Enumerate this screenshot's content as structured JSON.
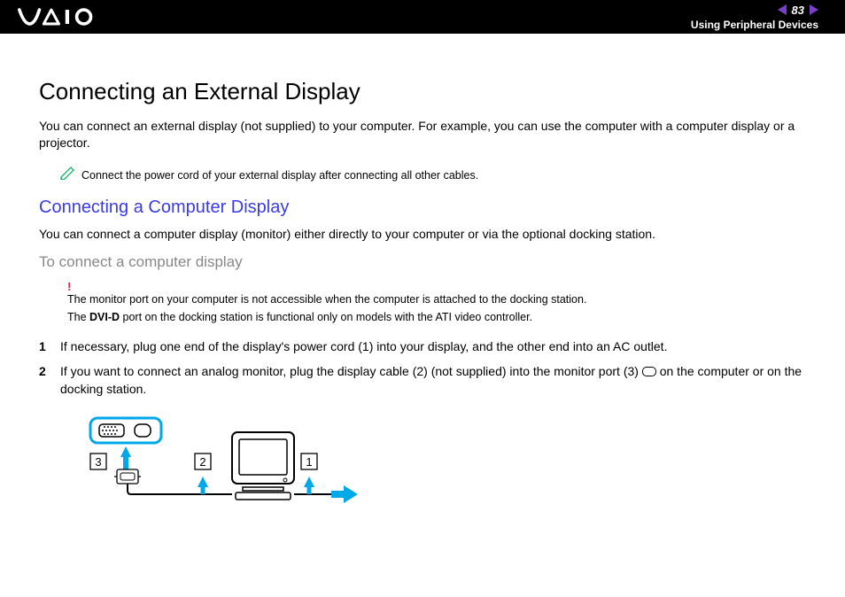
{
  "header": {
    "page_number": "83",
    "section": "Using Peripheral Devices"
  },
  "main": {
    "title": "Connecting an External Display",
    "intro": "You can connect an external display (not supplied) to your computer. For example, you can use the computer with a computer display or a projector.",
    "note": "Connect the power cord of your external display after connecting all other cables.",
    "subheading": "Connecting a Computer Display",
    "sub_intro": "You can connect a computer display (monitor) either directly to your computer or via the optional docking station.",
    "task_heading": "To connect a computer display",
    "warning": "The monitor port on your computer is not accessible when the computer is attached to the docking station.",
    "info_pre": "The ",
    "info_bold": "DVI-D",
    "info_post": " port on the docking station is functional only on models with the ATI video controller.",
    "steps": [
      "If necessary, plug one end of the display's power cord (1) into your display, and the other end into an AC outlet.",
      "If you want to connect an analog monitor, plug the display cable (2) (not supplied) into the monitor port (3)  on the computer or on the docking station."
    ],
    "diagram_labels": {
      "l1": "1",
      "l2": "2",
      "l3": "3"
    }
  }
}
